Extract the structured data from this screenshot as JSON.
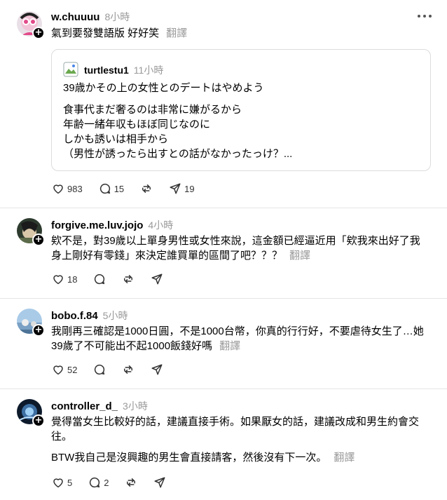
{
  "posts": [
    {
      "username": "w.chuuuu",
      "time": "8小時",
      "text": "氣到要發雙語版 好好笑",
      "translate": "翻譯",
      "quote": {
        "username": "turtlestu1",
        "time": "11小時",
        "title": "39歳かその上の女性とのデートはやめよう",
        "body": "食事代まだ奢るのは非常に嫌がるから\n年齢一緒年収もほぼ同じなのに\nしかも誘いは相手から\n（男性が誘ったら出すとの話がなかったっけ？..."
      },
      "likes": "983",
      "comments": "15",
      "shares": "19"
    },
    {
      "username": "forgive.me.luv.jojo",
      "time": "4小時",
      "text": "欸不是，對39歲以上單身男性或女性來說，這金額已經逼近用「欸我來出好了我身上剛好有零錢」來決定誰買單的區間了吧？？？",
      "translate": "翻譯",
      "likes": "18"
    },
    {
      "username": "bobo.f.84",
      "time": "5小時",
      "text": "我剛再三確認是1000日圓，不是1000台幣，你真的行行好，不要虐待女生了…她39歲了不可能出不起1000飯錢好嗎",
      "translate": "翻譯",
      "likes": "52"
    },
    {
      "username": "controller_d_",
      "time": "3小時",
      "text": "覺得當女生比較好的話，建議直接手術。如果厭女的話，建議改成和男生約會交往。",
      "text2": "BTW我自己是沒興趣的男生會直接請客，然後沒有下一次。",
      "translate": "翻譯",
      "likes": "5",
      "comments": "2"
    }
  ],
  "icons": {
    "heart": "heart-icon",
    "comment": "comment-icon",
    "repost": "repost-icon",
    "share": "share-icon",
    "more": "more-icon",
    "follow": "follow-plus-icon"
  }
}
